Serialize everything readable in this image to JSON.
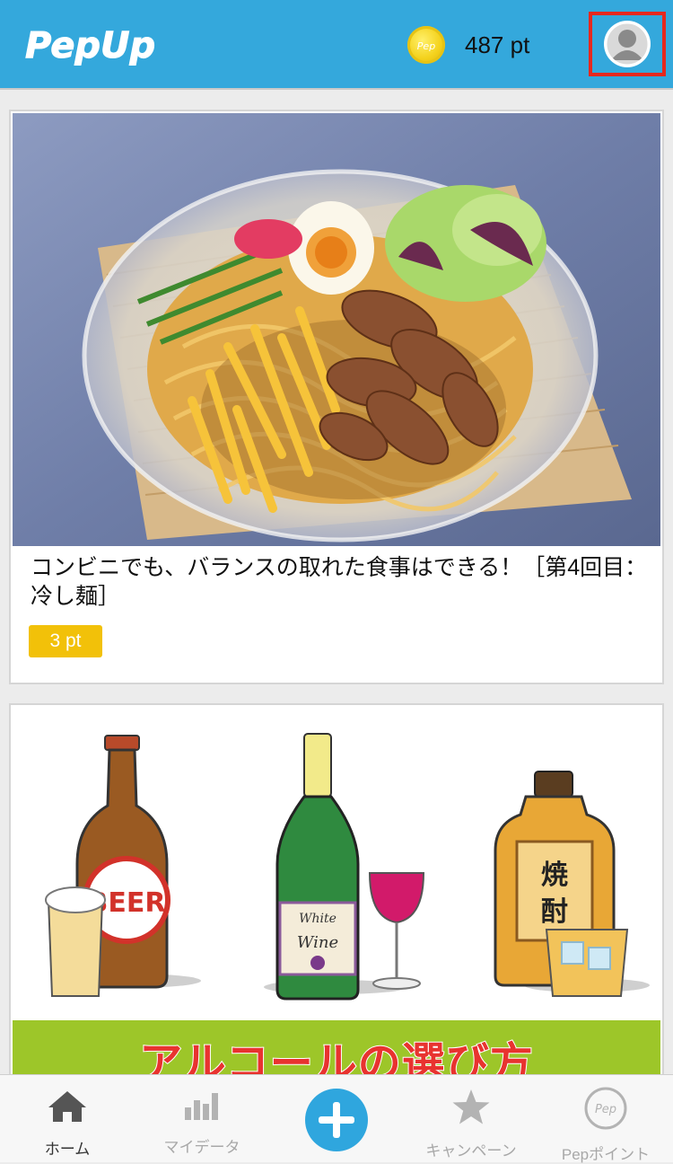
{
  "header": {
    "logo_text": "PepUp",
    "points": "487 pt",
    "coin_text": "Pep"
  },
  "feed": [
    {
      "title": "コンビニでも、バランスの取れた食事はできる！［第4回目：冷し麺］",
      "points": "3 pt"
    },
    {
      "bottle_labels": [
        "BEER",
        "White",
        "Wine",
        "焼",
        "酎"
      ],
      "banner_text": "アルコールの選び方"
    }
  ],
  "tabbar": {
    "items": [
      {
        "label": "ホーム",
        "icon": "home-icon",
        "active": true
      },
      {
        "label": "マイデータ",
        "icon": "bar-chart-icon",
        "active": false
      },
      {
        "label": "",
        "icon": "plus-icon",
        "active": false
      },
      {
        "label": "キャンペーン",
        "icon": "star-icon",
        "active": false
      },
      {
        "label": "Pepポイント",
        "icon": "pep-point-icon",
        "active": false
      }
    ]
  },
  "colors": {
    "header_bg": "#34a8dc",
    "highlight_border": "#e6281e",
    "badge_bg": "#f2c109",
    "banner_bg": "#9dc629",
    "banner_text": "#e8332f",
    "add_button": "#2fa6de"
  }
}
